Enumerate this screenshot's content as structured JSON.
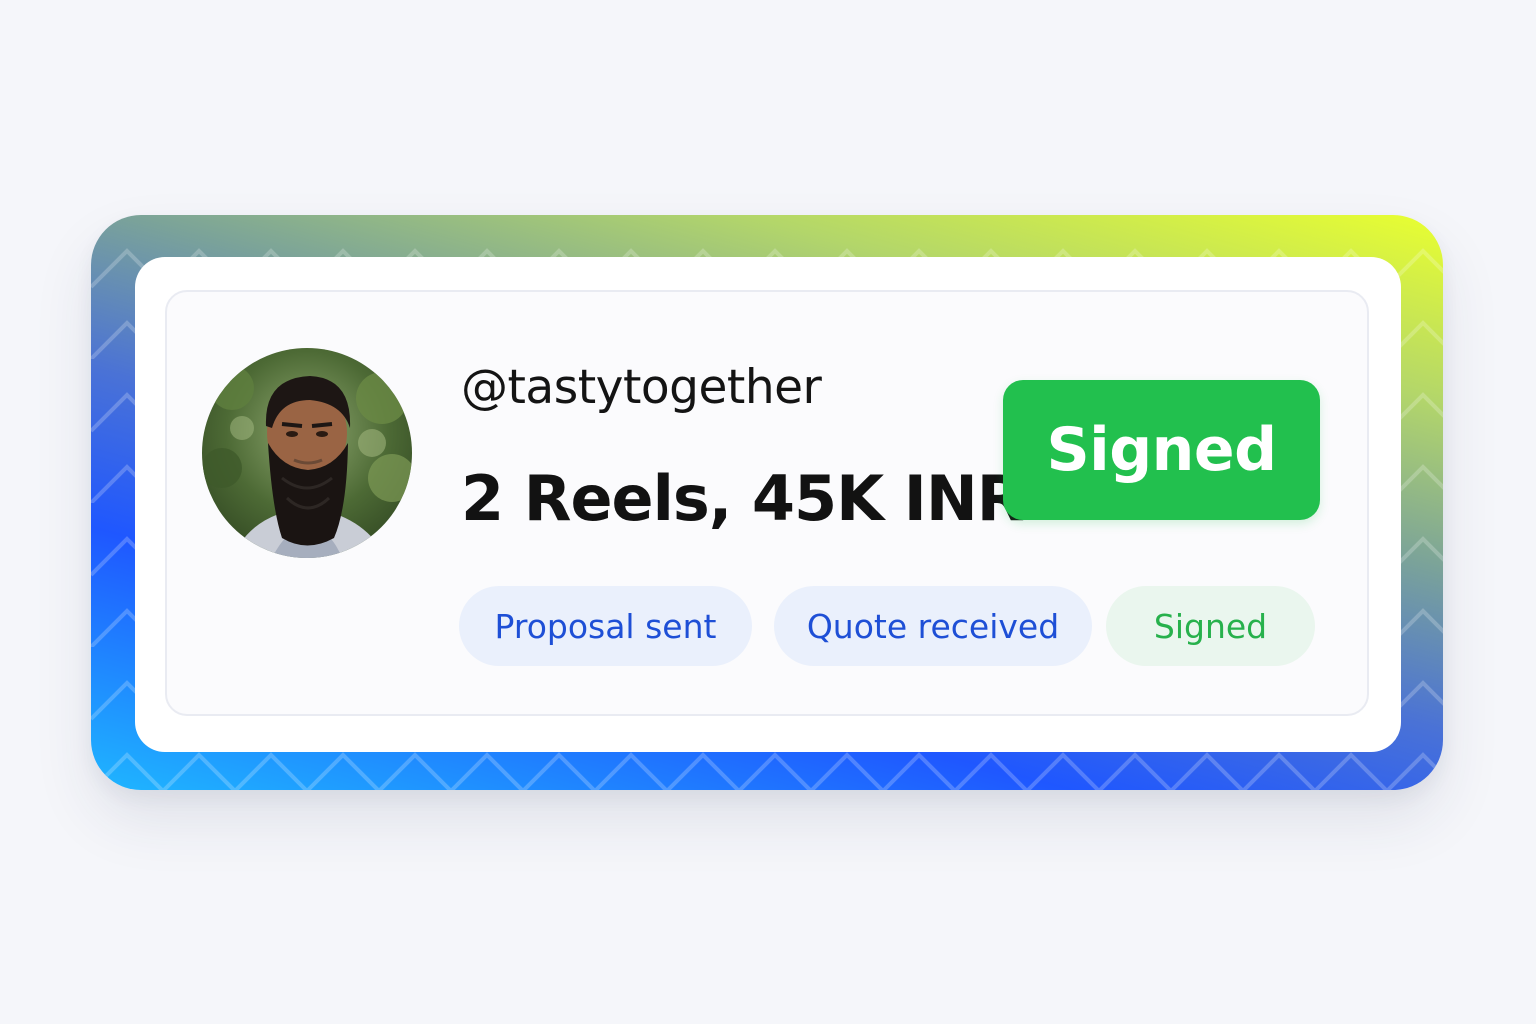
{
  "card": {
    "handle": "@tastytogether",
    "deal_summary": "2 Reels, 45K INR",
    "status_button_label": "Signed",
    "pipeline": [
      {
        "label": "Proposal sent",
        "variant": "blue"
      },
      {
        "label": "Quote received",
        "variant": "blue"
      },
      {
        "label": "Signed",
        "variant": "green"
      }
    ]
  },
  "colors": {
    "signed_green": "#22c04e",
    "pill_blue_text": "#1e4fd6",
    "pill_green_text": "#27b14c",
    "gradient_start": "#1fb6ff",
    "gradient_mid": "#1f57ff",
    "gradient_end": "#e9ff30"
  }
}
